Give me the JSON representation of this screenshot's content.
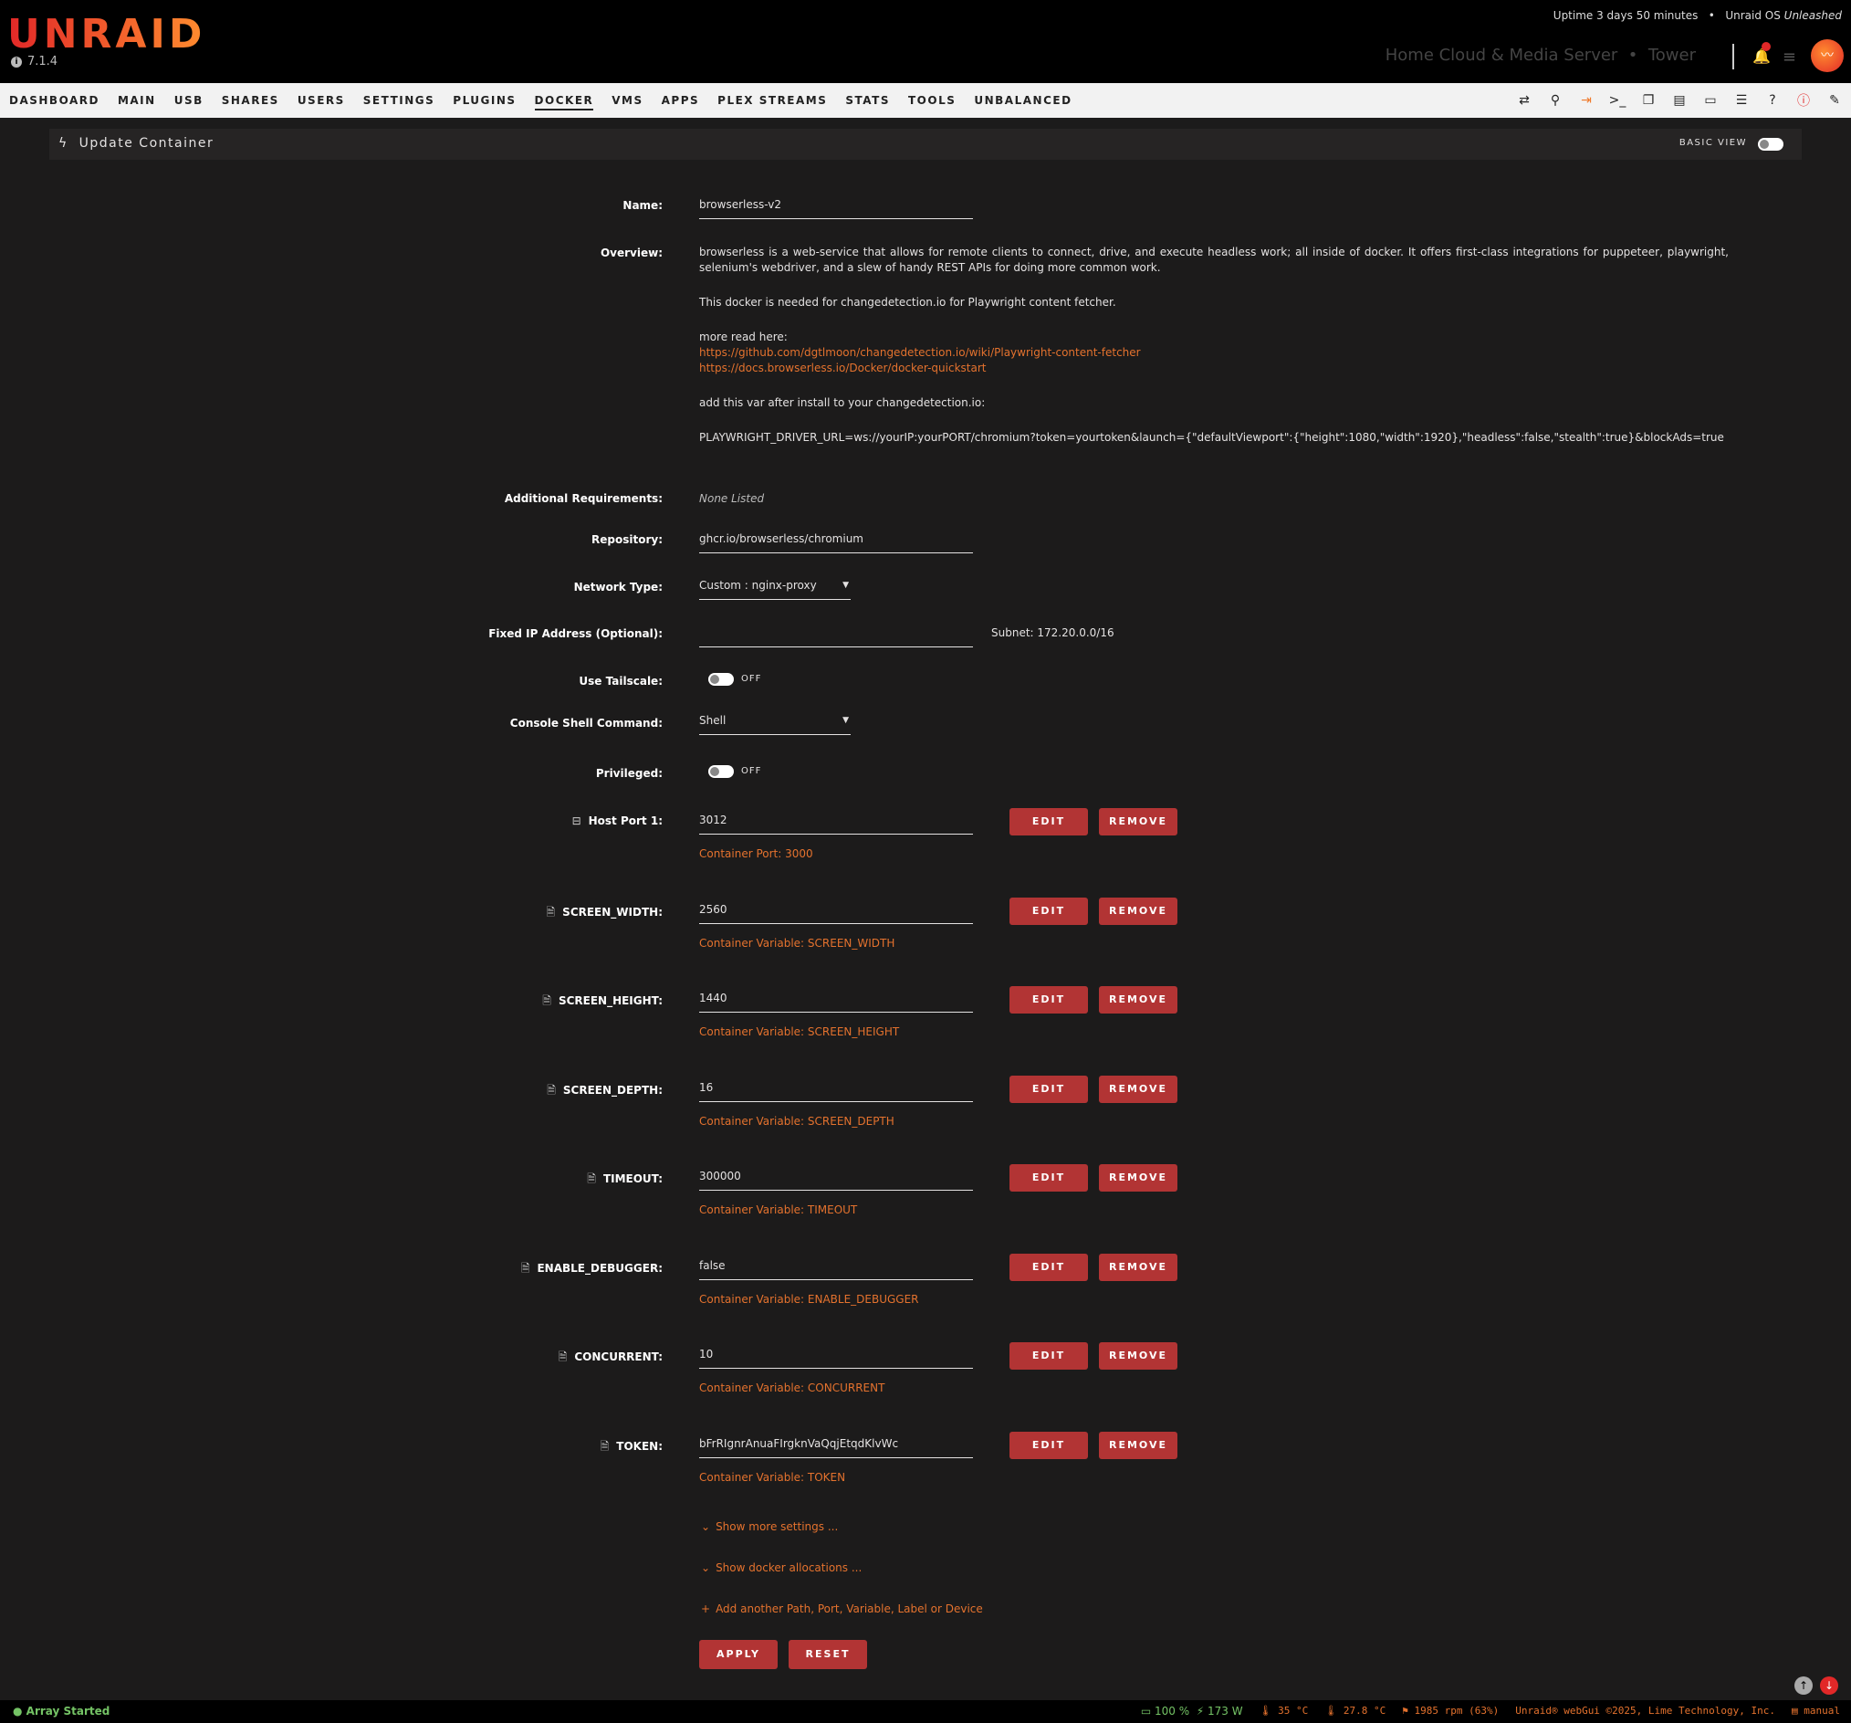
{
  "header": {
    "logo": "UNRAID",
    "version": "7.1.4",
    "uptime": "Uptime 3 days 50 minutes",
    "os_prefix": "Unraid OS",
    "os_edition": "Unleashed",
    "server_desc": "Home Cloud & Media Server",
    "server_name": "Tower"
  },
  "nav": {
    "items": [
      "DASHBOARD",
      "MAIN",
      "USB",
      "SHARES",
      "USERS",
      "SETTINGS",
      "PLUGINS",
      "DOCKER",
      "VMS",
      "APPS",
      "PLEX STREAMS",
      "STATS",
      "TOOLS",
      "UNBALANCED"
    ],
    "active": "DOCKER",
    "icons": [
      "switch-icon",
      "search-icon",
      "logout-icon",
      "terminal-icon",
      "copy-icon",
      "feedback-icon",
      "monitor-icon",
      "log-icon",
      "help-icon",
      "info-icon",
      "edit-icon"
    ]
  },
  "titlebar": {
    "title": "Update Container",
    "basic_view": "BASIC VIEW"
  },
  "form": {
    "name_label": "Name:",
    "name_value": "browserless-v2",
    "overview_label": "Overview:",
    "overview_p1": "browserless is a web-service that allows for remote clients to connect, drive, and execute headless work; all inside of docker. It offers first-class integrations for puppeteer, playwright, selenium's webdriver, and a slew of handy REST APIs for doing more common work.",
    "overview_p2": "This docker is needed for changedetection.io for Playwright content fetcher.",
    "overview_p3": "more read here:",
    "overview_link1": "https://github.com/dgtlmoon/changedetection.io/wiki/Playwright-content-fetcher",
    "overview_link2": "https://docs.browserless.io/Docker/docker-quickstart",
    "overview_p4": "add this var after install to your changedetection.io:",
    "overview_p5": "PLAYWRIGHT_DRIVER_URL=ws://yourIP:yourPORT/chromium?token=yourtoken&launch={\"defaultViewport\":{\"height\":1080,\"width\":1920},\"headless\":false,\"stealth\":true}&blockAds=true",
    "addreq_label": "Additional Requirements:",
    "addreq_value": "None Listed",
    "repo_label": "Repository:",
    "repo_value": "ghcr.io/browserless/chromium",
    "network_label": "Network Type:",
    "network_value": "Custom : nginx-proxy",
    "fixedip_label": "Fixed IP Address (Optional):",
    "fixedip_value": "",
    "subnet": "Subnet: 172.20.0.0/16",
    "tailscale_label": "Use Tailscale:",
    "tailscale_state": "OFF",
    "shell_label": "Console Shell Command:",
    "shell_value": "Shell",
    "privileged_label": "Privileged:",
    "privileged_state": "OFF",
    "edit_label": "EDIT",
    "remove_label": "REMOVE",
    "entries": [
      {
        "label": "Host Port 1:",
        "value": "3012",
        "sub": "Container Port: 3000",
        "icon": "minus-square-icon"
      },
      {
        "label": "SCREEN_WIDTH:",
        "value": "2560",
        "sub": "Container Variable: SCREEN_WIDTH",
        "icon": "file-icon"
      },
      {
        "label": "SCREEN_HEIGHT:",
        "value": "1440",
        "sub": "Container Variable: SCREEN_HEIGHT",
        "icon": "file-icon"
      },
      {
        "label": "SCREEN_DEPTH:",
        "value": "16",
        "sub": "Container Variable: SCREEN_DEPTH",
        "icon": "file-icon"
      },
      {
        "label": "TIMEOUT:",
        "value": "300000",
        "sub": "Container Variable: TIMEOUT",
        "icon": "file-icon"
      },
      {
        "label": "ENABLE_DEBUGGER:",
        "value": "false",
        "sub": "Container Variable: ENABLE_DEBUGGER",
        "icon": "file-icon"
      },
      {
        "label": "CONCURRENT:",
        "value": "10",
        "sub": "Container Variable: CONCURRENT",
        "icon": "file-icon"
      },
      {
        "label": "TOKEN:",
        "value": "bFrRIgnrAnuaFIrgknVaQqjEtqdKlvWc",
        "sub": "Container Variable: TOKEN",
        "icon": "file-icon"
      }
    ],
    "show_more": "Show more settings ...",
    "show_alloc": "Show docker allocations ...",
    "add_another": "Add another Path, Port, Variable, Label or Device",
    "apply": "APPLY",
    "reset": "RESET"
  },
  "footer": {
    "array": "Array Started",
    "ups": "100 %",
    "power": "173 W",
    "cpu_temp": "35 °C",
    "mb_temp": "27.8 °C",
    "fan": "1985 rpm (63%)",
    "copyright": "Unraid® webGui ©2025, Lime Technology, Inc.",
    "manual": "manual"
  },
  "colors": {
    "accent": "#e4722e",
    "button": "#b23434",
    "green": "#74c365",
    "background": "#1c1b1b"
  }
}
